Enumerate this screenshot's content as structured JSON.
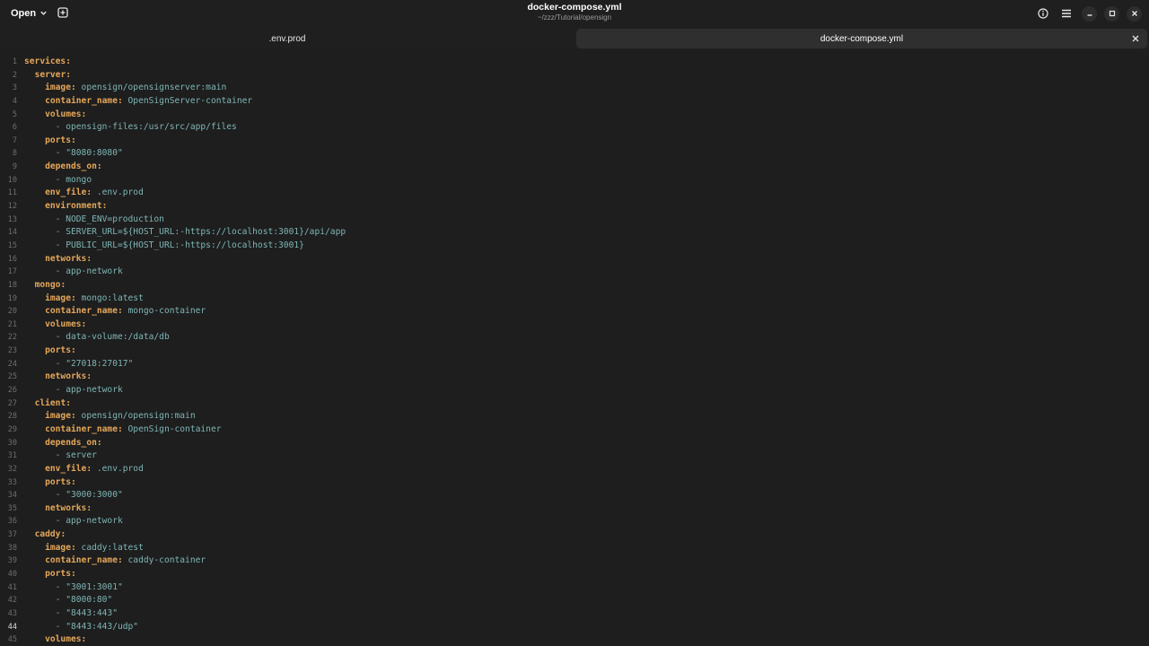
{
  "header": {
    "open_label": "Open",
    "title": "docker-compose.yml",
    "subtitle": "~/zzz/Tutorial/opensign"
  },
  "tabs": [
    {
      "label": ".env.prod",
      "active": false
    },
    {
      "label": "docker-compose.yml",
      "active": true
    }
  ],
  "icons": {
    "new_tab": "new-tab-icon",
    "info": "info-icon",
    "menu": "hamburger-menu-icon",
    "minimize": "minimize-icon",
    "maximize": "maximize-icon",
    "close": "close-icon"
  },
  "colors": {
    "background": "#1e1e1e",
    "key": "#e5a75a",
    "value": "#7fb5b5",
    "line_number": "#6e6e6e",
    "active_tab": "#2f2f2f"
  },
  "editor": {
    "cursor_line": 44,
    "lines": [
      {
        "n": "1",
        "indent": "",
        "dash": "",
        "key": "services:",
        "val": ""
      },
      {
        "n": "2",
        "indent": "  ",
        "dash": "",
        "key": "server:",
        "val": ""
      },
      {
        "n": "3",
        "indent": "    ",
        "dash": "",
        "key": "image:",
        "val": " opensign/opensignserver:main"
      },
      {
        "n": "4",
        "indent": "    ",
        "dash": "",
        "key": "container_name:",
        "val": " OpenSignServer-container"
      },
      {
        "n": "5",
        "indent": "    ",
        "dash": "",
        "key": "volumes:",
        "val": ""
      },
      {
        "n": "6",
        "indent": "      ",
        "dash": "- ",
        "key": "",
        "val": "opensign-files:/usr/src/app/files"
      },
      {
        "n": "7",
        "indent": "    ",
        "dash": "",
        "key": "ports:",
        "val": ""
      },
      {
        "n": "8",
        "indent": "      ",
        "dash": "- ",
        "key": "",
        "val": "\"8080:8080\""
      },
      {
        "n": "9",
        "indent": "    ",
        "dash": "",
        "key": "depends_on:",
        "val": ""
      },
      {
        "n": "10",
        "indent": "      ",
        "dash": "- ",
        "key": "",
        "val": "mongo"
      },
      {
        "n": "11",
        "indent": "    ",
        "dash": "",
        "key": "env_file:",
        "val": " .env.prod"
      },
      {
        "n": "12",
        "indent": "    ",
        "dash": "",
        "key": "environment:",
        "val": ""
      },
      {
        "n": "13",
        "indent": "      ",
        "dash": "- ",
        "key": "",
        "val": "NODE_ENV=production"
      },
      {
        "n": "14",
        "indent": "      ",
        "dash": "- ",
        "key": "",
        "val": "SERVER_URL=${HOST_URL:-https://localhost:3001}/api/app"
      },
      {
        "n": "15",
        "indent": "      ",
        "dash": "- ",
        "key": "",
        "val": "PUBLIC_URL=${HOST_URL:-https://localhost:3001}"
      },
      {
        "n": "16",
        "indent": "    ",
        "dash": "",
        "key": "networks:",
        "val": ""
      },
      {
        "n": "17",
        "indent": "      ",
        "dash": "- ",
        "key": "",
        "val": "app-network"
      },
      {
        "n": "18",
        "indent": "  ",
        "dash": "",
        "key": "mongo:",
        "val": ""
      },
      {
        "n": "19",
        "indent": "    ",
        "dash": "",
        "key": "image:",
        "val": " mongo:latest"
      },
      {
        "n": "20",
        "indent": "    ",
        "dash": "",
        "key": "container_name:",
        "val": " mongo-container"
      },
      {
        "n": "21",
        "indent": "    ",
        "dash": "",
        "key": "volumes:",
        "val": ""
      },
      {
        "n": "22",
        "indent": "      ",
        "dash": "- ",
        "key": "",
        "val": "data-volume:/data/db"
      },
      {
        "n": "23",
        "indent": "    ",
        "dash": "",
        "key": "ports:",
        "val": ""
      },
      {
        "n": "24",
        "indent": "      ",
        "dash": "- ",
        "key": "",
        "val": "\"27018:27017\""
      },
      {
        "n": "25",
        "indent": "    ",
        "dash": "",
        "key": "networks:",
        "val": ""
      },
      {
        "n": "26",
        "indent": "      ",
        "dash": "- ",
        "key": "",
        "val": "app-network"
      },
      {
        "n": "27",
        "indent": "  ",
        "dash": "",
        "key": "client:",
        "val": ""
      },
      {
        "n": "28",
        "indent": "    ",
        "dash": "",
        "key": "image:",
        "val": " opensign/opensign:main"
      },
      {
        "n": "29",
        "indent": "    ",
        "dash": "",
        "key": "container_name:",
        "val": " OpenSign-container"
      },
      {
        "n": "30",
        "indent": "    ",
        "dash": "",
        "key": "depends_on:",
        "val": ""
      },
      {
        "n": "31",
        "indent": "      ",
        "dash": "- ",
        "key": "",
        "val": "server"
      },
      {
        "n": "32",
        "indent": "    ",
        "dash": "",
        "key": "env_file:",
        "val": " .env.prod"
      },
      {
        "n": "33",
        "indent": "    ",
        "dash": "",
        "key": "ports:",
        "val": ""
      },
      {
        "n": "34",
        "indent": "      ",
        "dash": "- ",
        "key": "",
        "val": "\"3000:3000\""
      },
      {
        "n": "35",
        "indent": "    ",
        "dash": "",
        "key": "networks:",
        "val": ""
      },
      {
        "n": "36",
        "indent": "      ",
        "dash": "- ",
        "key": "",
        "val": "app-network"
      },
      {
        "n": "37",
        "indent": "  ",
        "dash": "",
        "key": "caddy:",
        "val": ""
      },
      {
        "n": "38",
        "indent": "    ",
        "dash": "",
        "key": "image:",
        "val": " caddy:latest"
      },
      {
        "n": "39",
        "indent": "    ",
        "dash": "",
        "key": "container_name:",
        "val": " caddy-container"
      },
      {
        "n": "40",
        "indent": "    ",
        "dash": "",
        "key": "ports:",
        "val": ""
      },
      {
        "n": "41",
        "indent": "      ",
        "dash": "- ",
        "key": "",
        "val": "\"3001:3001\""
      },
      {
        "n": "42",
        "indent": "      ",
        "dash": "- ",
        "key": "",
        "val": "\"8000:80\""
      },
      {
        "n": "43",
        "indent": "      ",
        "dash": "- ",
        "key": "",
        "val": "\"8443:443\""
      },
      {
        "n": "44",
        "indent": "      ",
        "dash": "- ",
        "key": "",
        "val": "\"8443:443/udp\""
      },
      {
        "n": "45",
        "indent": "    ",
        "dash": "",
        "key": "volumes:",
        "val": ""
      }
    ]
  }
}
